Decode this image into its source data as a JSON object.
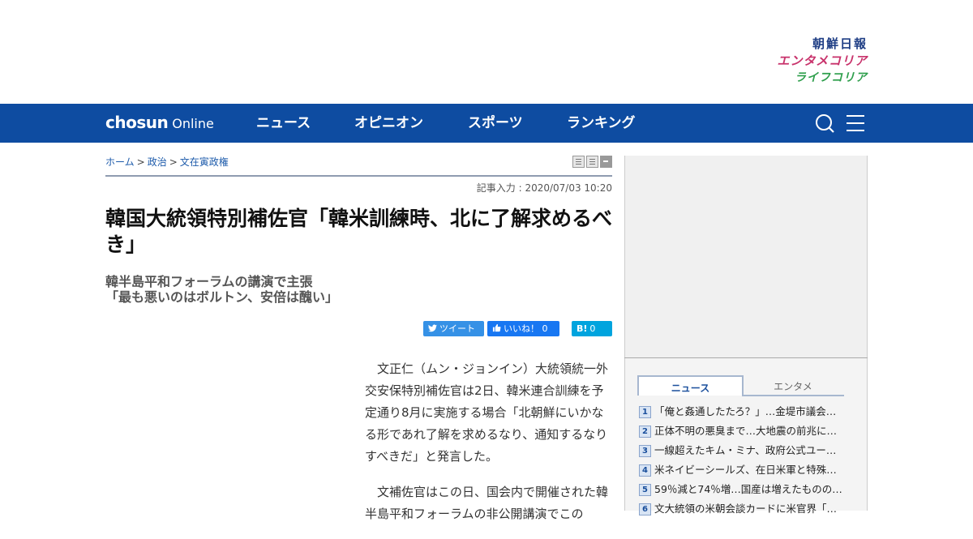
{
  "brands": {
    "chosun": "朝鮮日報",
    "entame": "エンタメコリア",
    "life": "ライフコリア"
  },
  "nav": {
    "logo_bold": "chosun",
    "logo_light": "Online",
    "items": [
      "ニュース",
      "オピニオン",
      "スポーツ",
      "ランキング"
    ],
    "search_icon": "search-icon",
    "menu_icon": "hamburger-menu-icon"
  },
  "breadcrumb": [
    "ホーム",
    "政治",
    "文在寅政権"
  ],
  "article": {
    "timestamp": "記事入力 : 2020/07/03 10:20",
    "headline": "韓国大統領特別補佐官「韓米訓練時、北に了解求めるべき」",
    "subhead": [
      "韓半島平和フォーラムの講演で主張",
      "「最も悪いのはボルトン、安倍は醜い」"
    ],
    "body": [
      "文正仁（ムン・ジョンイン）大統領統一外交安保特別補佐官は2日、韓米連合訓練を予定通り8月に実施する場合「北朝鮮にいかなる形であれ了解を求めるなり、通知するなりすべきだ」と発言した。",
      "文補佐官はこの日、国会内で開催された韓半島平和フォーラムの非公開講演でこの"
    ]
  },
  "social": {
    "tweet": "ツイート",
    "like": "いいね！",
    "like_count": "0",
    "hatena": "B!",
    "hatena_count": "0"
  },
  "sidebar": {
    "tabs": [
      "ニュース",
      "エンタメ"
    ],
    "active_tab": "ニュース",
    "ranking": [
      {
        "rank": "1",
        "title": "「俺と姦通したたろ？」…金堤市議会…"
      },
      {
        "rank": "2",
        "title": "正体不明の悪臭まで…大地震の前兆に…"
      },
      {
        "rank": "3",
        "title": "一線超えたキム・ミナ、政府公式ユー…"
      },
      {
        "rank": "4",
        "title": "米ネイビーシールズ、在日米軍と特殊…"
      },
      {
        "rank": "5",
        "title": "59％減と74％増…国産は増えたものの…"
      },
      {
        "rank": "6",
        "title": "文大統領の米朝会談カードに米官界「…"
      }
    ]
  },
  "colors": {
    "nav_blue": "#0e4ca1",
    "link_blue": "#1d5bab",
    "entame_pink": "#c8326b",
    "life_green": "#2d9e4b"
  }
}
